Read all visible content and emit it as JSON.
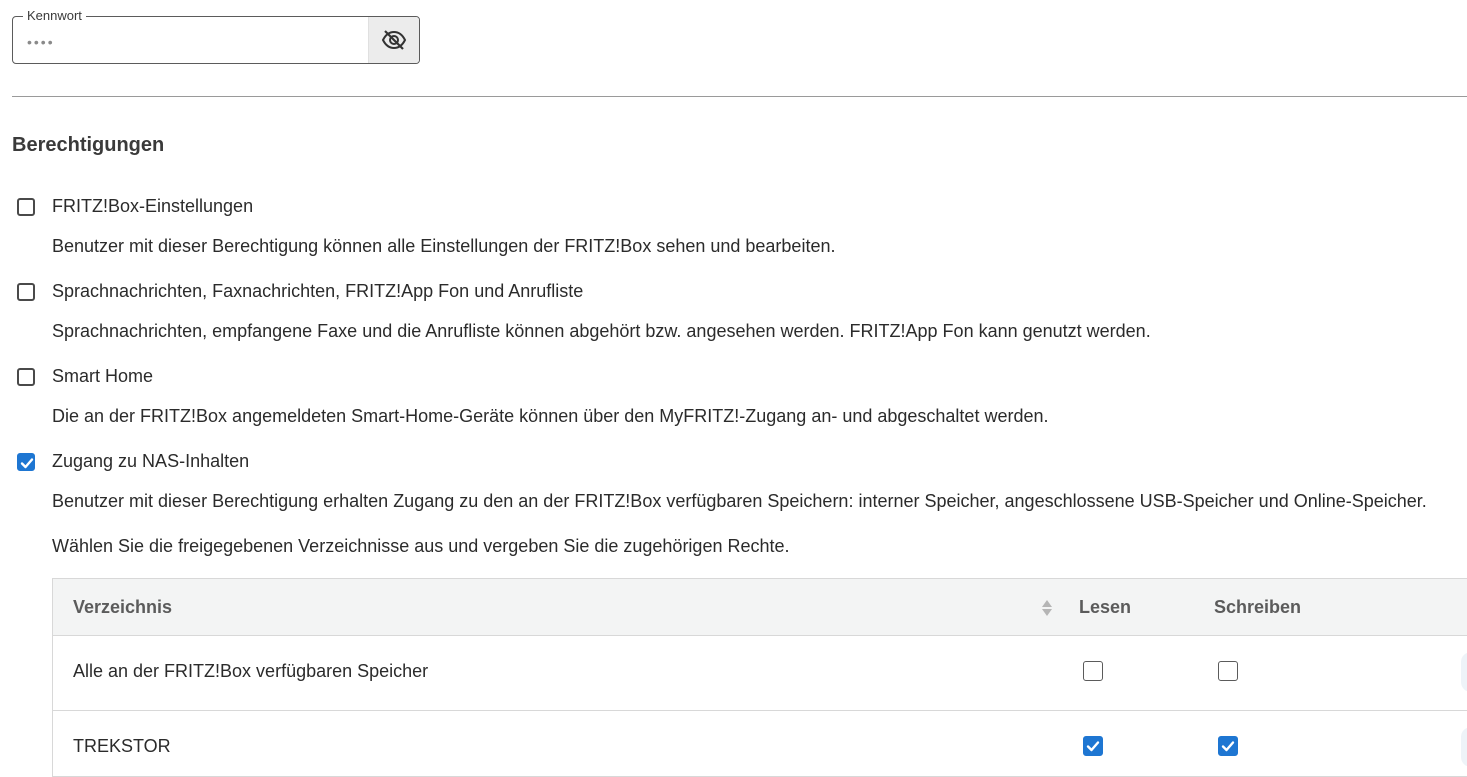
{
  "password": {
    "legend": "Kennwort",
    "value": "••••",
    "toggle_icon": "eye-slash-icon"
  },
  "section_title": "Berechtigungen",
  "permissions": [
    {
      "label": "FRITZ!Box-Einstellungen",
      "description": "Benutzer mit dieser Berechtigung können alle Einstellungen der FRITZ!Box sehen und bearbeiten.",
      "checked": false
    },
    {
      "label": "Sprachnachrichten, Faxnachrichten, FRITZ!App Fon und Anrufliste",
      "description": "Sprachnachrichten, empfangene Faxe und die Anrufliste können abgehört bzw. angesehen werden. FRITZ!App Fon kann genutzt werden.",
      "checked": false
    },
    {
      "label": "Smart Home",
      "description": "Die an der FRITZ!Box angemeldeten Smart-Home-Geräte können über den MyFRITZ!-Zugang an- und abgeschaltet werden.",
      "checked": false
    },
    {
      "label": "Zugang zu NAS-Inhalten",
      "description": "Benutzer mit dieser Berechtigung erhalten Zugang zu den an der FRITZ!Box verfügbaren Speichern: interner Speicher, angeschlossene USB-Speicher und Online-Speicher.",
      "description2": "Wählen Sie die freigegebenen Verzeichnisse aus und vergeben Sie die zugehörigen Rechte.",
      "checked": true
    }
  ],
  "nas_table": {
    "headers": {
      "directory": "Verzeichnis",
      "read": "Lesen",
      "write": "Schreiben"
    },
    "rows": [
      {
        "name": "Alle an der FRITZ!Box verfügbaren Speicher",
        "read": false,
        "write": false
      },
      {
        "name": "TREKSTOR",
        "read": true,
        "write": true
      }
    ]
  },
  "colors": {
    "accent": "#1e76d2",
    "header_bg": "#f3f4f4"
  }
}
